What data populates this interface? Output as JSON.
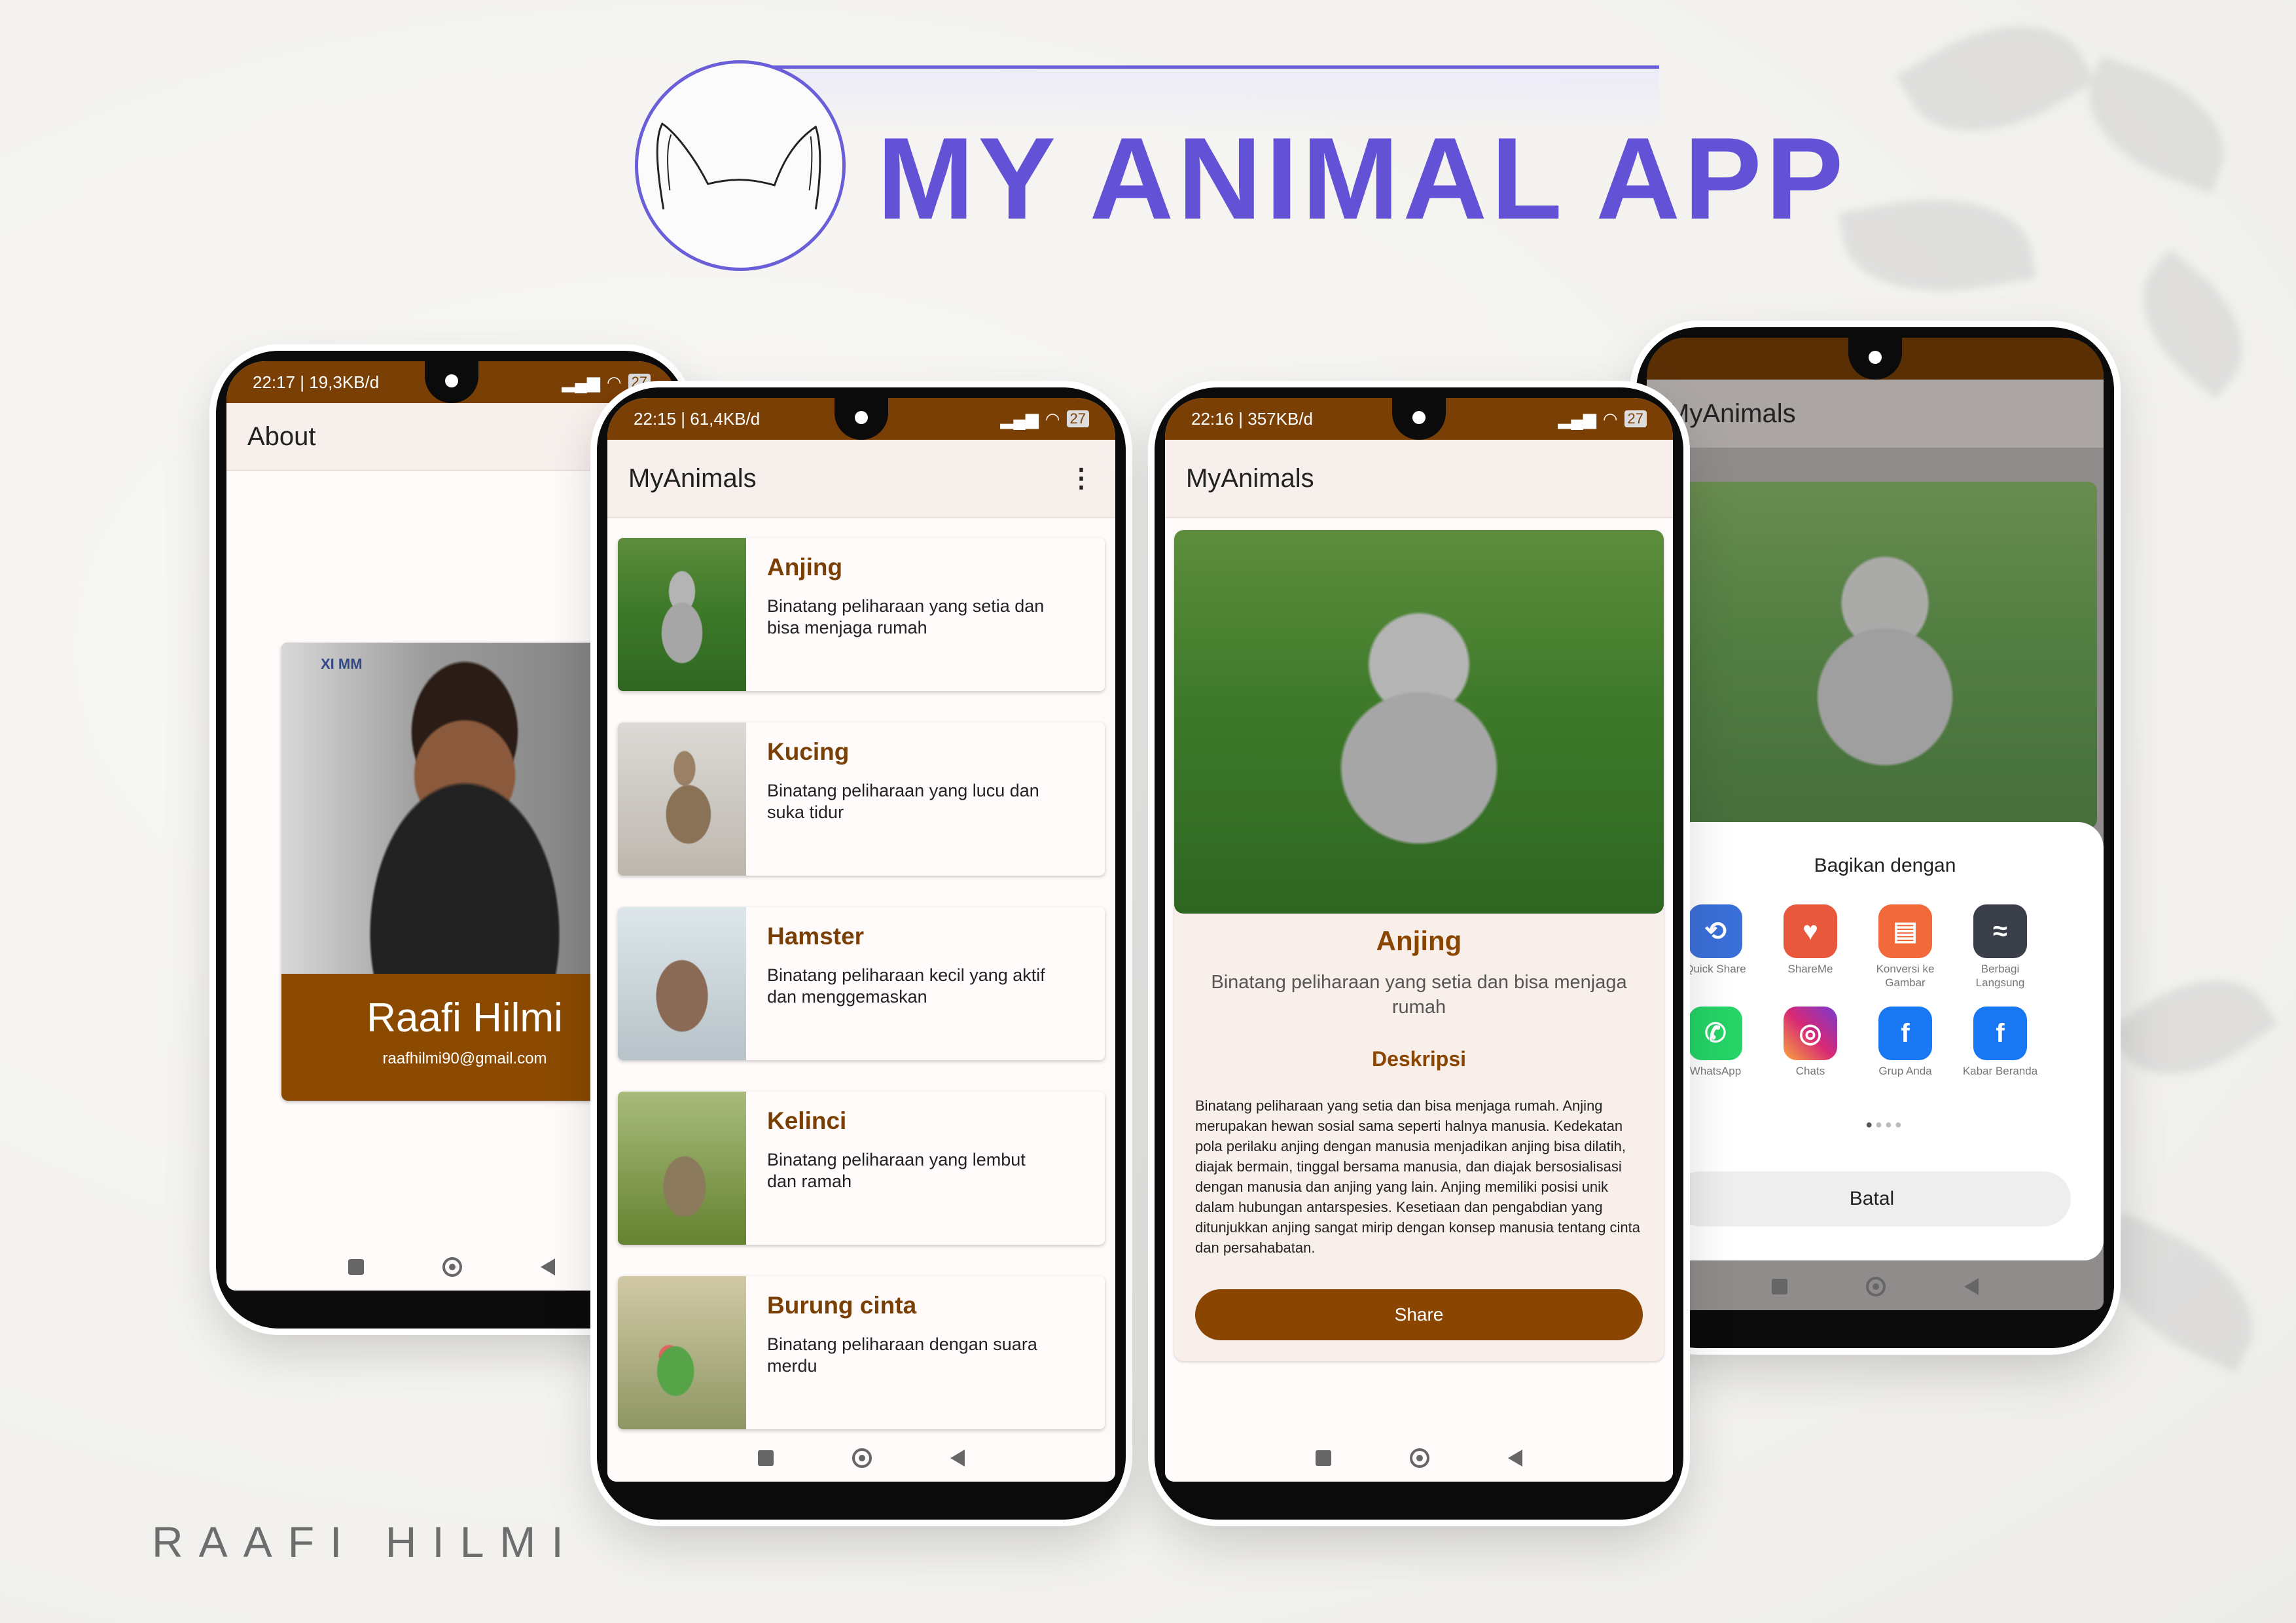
{
  "header": {
    "title": "MY ANIMAL APP",
    "signature": "RAAFI HILMI",
    "brand_color": "#6351d6"
  },
  "about_screen": {
    "status_time": "22:17 | 19,3KB/d",
    "battery": "27",
    "title": "About",
    "name": "Raafi Hilmi",
    "email": "raafhilmi90@gmail.com",
    "photo_sign": "XI MM"
  },
  "list_screen": {
    "status_time": "22:15 | 61,4KB/d",
    "battery": "27",
    "title": "MyAnimals",
    "items": [
      {
        "name": "Anjing",
        "desc": "Binatang peliharaan yang setia dan bisa menjaga rumah"
      },
      {
        "name": "Kucing",
        "desc": "Binatang peliharaan yang lucu dan suka tidur"
      },
      {
        "name": "Hamster",
        "desc": "Binatang peliharaan kecil yang aktif dan menggemaskan"
      },
      {
        "name": "Kelinci",
        "desc": "Binatang peliharaan yang lembut dan ramah"
      },
      {
        "name": "Burung cinta",
        "desc": "Binatang peliharaan dengan suara merdu"
      }
    ]
  },
  "detail_screen": {
    "status_time": "22:16 | 357KB/d",
    "battery": "27",
    "title": "MyAnimals",
    "name": "Anjing",
    "subtitle": "Binatang peliharaan yang setia dan bisa menjaga rumah",
    "section_title": "Deskripsi",
    "description": "Binatang peliharaan yang setia dan bisa menjaga rumah. Anjing merupakan hewan sosial sama seperti halnya manusia. Kedekatan pola perilaku anjing dengan manusia menjadikan anjing bisa dilatih, diajak bermain, tinggal bersama manusia, dan diajak bersosialisasi dengan manusia dan anjing yang lain. Anjing memiliki posisi unik dalam hubungan antarspesies. Kesetiaan dan pengabdian yang ditunjukkan anjing sangat mirip dengan konsep manusia tentang cinta dan persahabatan.",
    "share_button": "Share"
  },
  "share_screen": {
    "title": "MyAnimals",
    "sheet_title": "Bagikan dengan",
    "apps": [
      {
        "label": "Quick Share",
        "icon": "quick-share-icon",
        "color": "#3b6fd8"
      },
      {
        "label": "ShareMe",
        "icon": "shareme-icon",
        "color": "#e8583d"
      },
      {
        "label": "Konversi ke Gambar",
        "icon": "convert-image-icon",
        "color": "#f26a3c"
      },
      {
        "label": "Berbagi Langsung",
        "icon": "direct-share-icon",
        "color": "#3a3f4a"
      },
      {
        "label": "WhatsApp",
        "icon": "whatsapp-icon",
        "color": "#25d366"
      },
      {
        "label": "Chats",
        "icon": "instagram-icon",
        "color": "#d62976"
      },
      {
        "label": "Grup Anda",
        "icon": "facebook-icon",
        "color": "#1877f2"
      },
      {
        "label": "Kabar Beranda",
        "icon": "facebook-icon",
        "color": "#1877f2"
      }
    ],
    "cancel_button": "Batal"
  },
  "colors": {
    "status_bar": "#7a3f05",
    "accent": "#8a4500",
    "card_brown": "#8b4a00"
  }
}
